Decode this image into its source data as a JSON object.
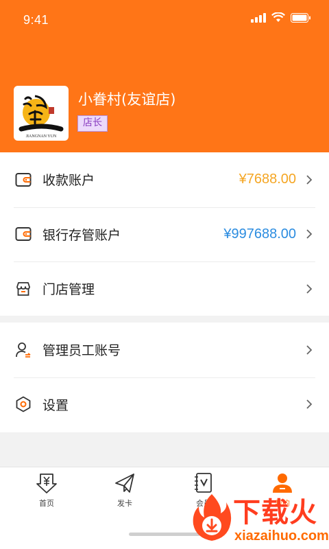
{
  "status_bar": {
    "time": "9:41"
  },
  "store": {
    "name": "小眷村(友谊店)",
    "role": "店长",
    "logo_text": "JIANGNAN YUN"
  },
  "accounts": [
    {
      "label": "收款账户",
      "value": "¥7688.00",
      "value_color": "#f5a623",
      "icon": "wallet-icon"
    },
    {
      "label": "银行存管账户",
      "value": "¥997688.00",
      "value_color": "#2b8ce0",
      "icon": "wallet-icon"
    },
    {
      "label": "门店管理",
      "value": "",
      "icon": "store-icon"
    }
  ],
  "settings": [
    {
      "label": "管理员工账号",
      "icon": "staff-icon"
    },
    {
      "label": "设置",
      "icon": "settings-hexagon-icon"
    }
  ],
  "tabs": [
    {
      "label": "首页",
      "icon": "home-yen-icon",
      "active": false
    },
    {
      "label": "发卡",
      "icon": "send-plane-icon",
      "active": false
    },
    {
      "label": "会员",
      "icon": "member-book-icon",
      "active": false
    },
    {
      "label": "我的",
      "icon": "profile-icon",
      "active": true
    }
  ],
  "watermark": {
    "title": "下载火",
    "subtitle": "xiazaihuo.com"
  },
  "colors": {
    "brand": "#ff7517",
    "active_tab": "#ff6a00"
  }
}
